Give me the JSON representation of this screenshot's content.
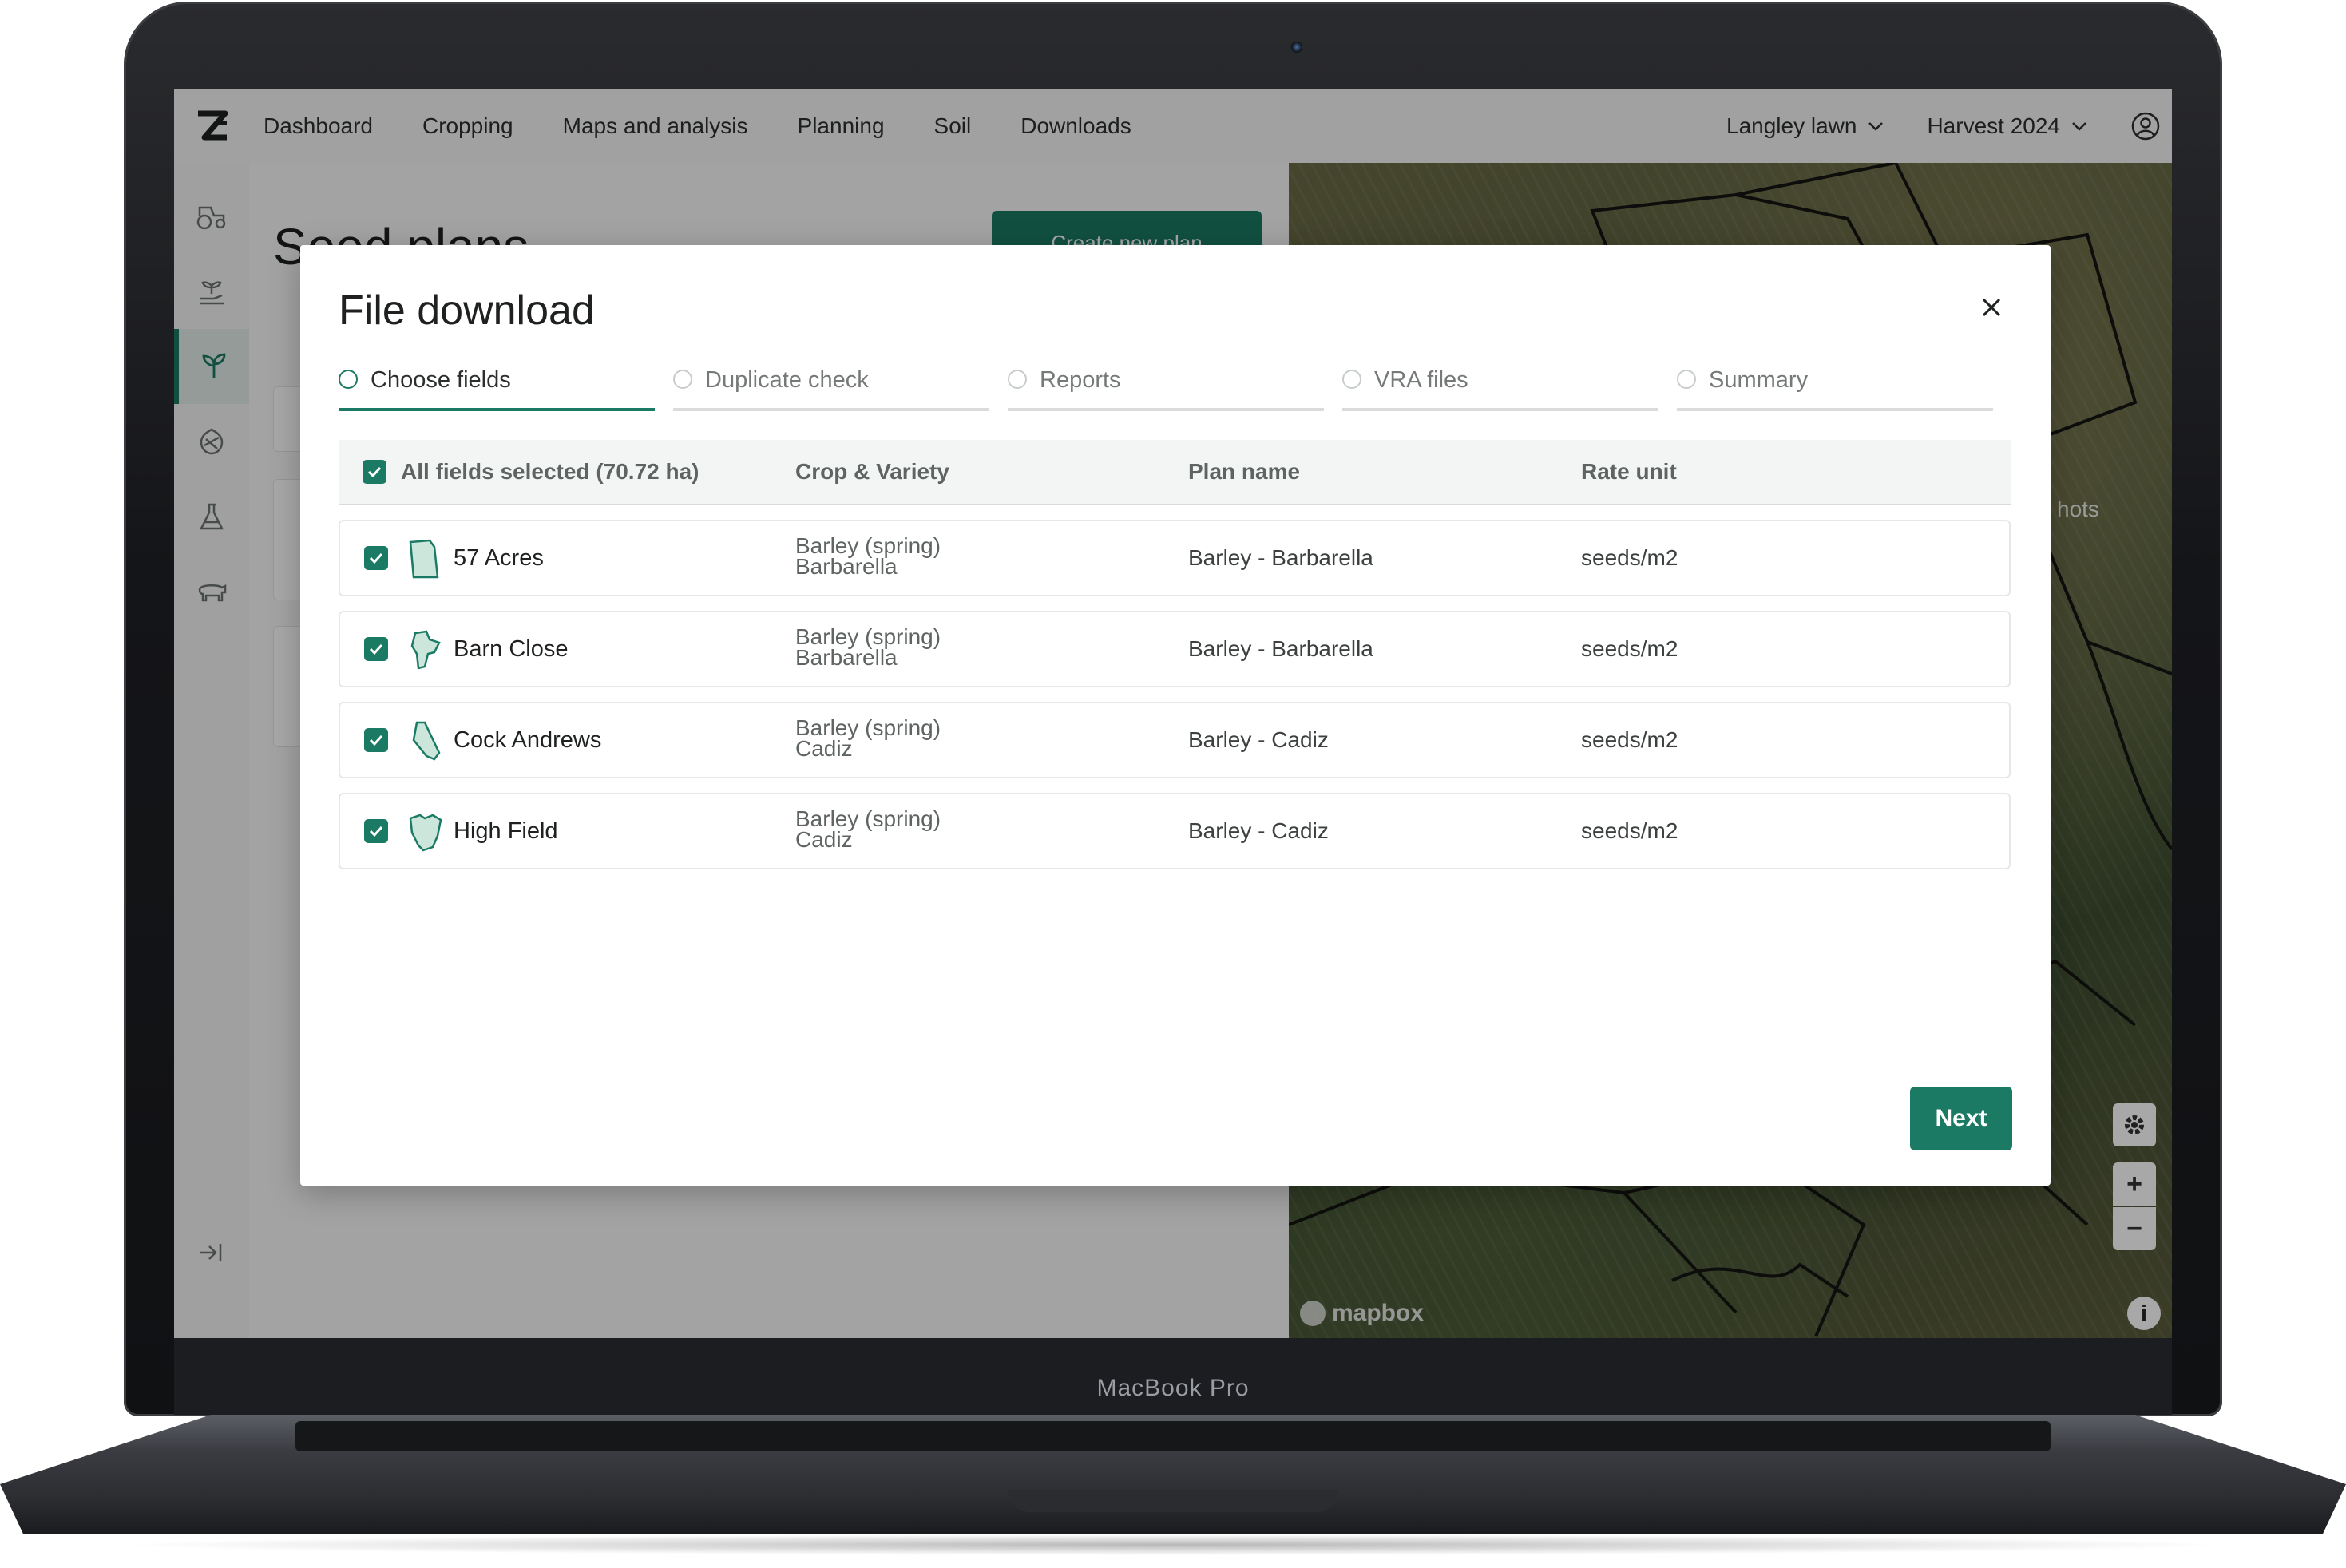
{
  "device": {
    "brand": "MacBook Pro"
  },
  "app": {
    "nav": [
      "Dashboard",
      "Cropping",
      "Maps and analysis",
      "Planning",
      "Soil",
      "Downloads"
    ],
    "farm_selector": "Langley lawn",
    "season_selector": "Harvest 2024"
  },
  "sidebar": {
    "icons": [
      "tractor-icon",
      "seedling-hand-icon",
      "sprout-icon",
      "fertiliser-icon",
      "flask-icon",
      "livestock-icon"
    ],
    "active_index": 2,
    "collapse_icon": "expand-sidebar-icon"
  },
  "background_page": {
    "title": "Seed plans",
    "create_button": "Create new plan"
  },
  "map": {
    "partial_label": "hots",
    "attribution": "mapbox",
    "controls": [
      "gear-icon",
      "zoom-in-icon",
      "zoom-out-icon",
      "info-icon"
    ]
  },
  "modal": {
    "title": "File download",
    "steps": [
      "Choose fields",
      "Duplicate check",
      "Reports",
      "VRA files",
      "Summary"
    ],
    "active_step": 0,
    "table": {
      "select_all_label": "All fields selected (70.72 ha)",
      "headers": [
        "Crop & Variety",
        "Plan name",
        "Rate unit"
      ],
      "rows": [
        {
          "name": "57 Acres",
          "crop": "Barley (spring)",
          "variety": "Barbarella",
          "plan": "Barley - Barbarella",
          "rate_unit": "seeds/m2",
          "checked": true
        },
        {
          "name": "Barn Close",
          "crop": "Barley (spring)",
          "variety": "Barbarella",
          "plan": "Barley - Barbarella",
          "rate_unit": "seeds/m2",
          "checked": true
        },
        {
          "name": "Cock Andrews",
          "crop": "Barley (spring)",
          "variety": "Cadiz",
          "plan": "Barley - Cadiz",
          "rate_unit": "seeds/m2",
          "checked": true
        },
        {
          "name": "High Field",
          "crop": "Barley (spring)",
          "variety": "Cadiz",
          "plan": "Barley - Cadiz",
          "rate_unit": "seeds/m2",
          "checked": true
        }
      ]
    },
    "next_button": "Next"
  },
  "colors": {
    "accent": "#1b7a63",
    "field_fill": "#cde6dc",
    "field_stroke": "#1b7a63"
  }
}
